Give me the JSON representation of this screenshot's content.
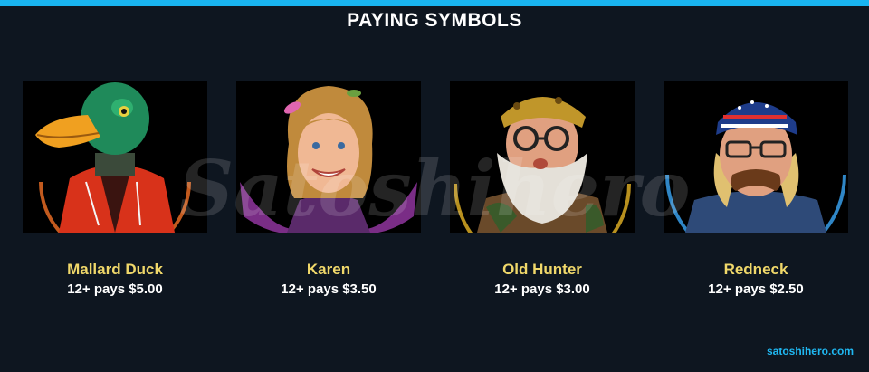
{
  "header": {
    "title": "PAYING SYMBOLS",
    "accent_color": "#19b4f0"
  },
  "watermark": {
    "text": "Satoshihero"
  },
  "symbols": [
    {
      "name": "Mallard Duck",
      "payout": "12+ pays $5.00",
      "icon": "mallard-duck-portrait",
      "ring_color": "#c25a1e"
    },
    {
      "name": "Karen",
      "payout": "12+ pays $3.50",
      "icon": "karen-portrait",
      "ring_color": "#8a3c96"
    },
    {
      "name": "Old Hunter",
      "payout": "12+ pays $3.00",
      "icon": "old-hunter-portrait",
      "ring_color": "#b8901e"
    },
    {
      "name": "Redneck",
      "payout": "12+ pays $2.50",
      "icon": "redneck-portrait",
      "ring_color": "#2f86c6"
    }
  ],
  "footer": {
    "site": "satoshihero.com"
  },
  "colors": {
    "background": "#0e1620",
    "symbol_name": "#f0d86a",
    "payout_text": "#ffffff",
    "site_link": "#1fb8f2"
  }
}
